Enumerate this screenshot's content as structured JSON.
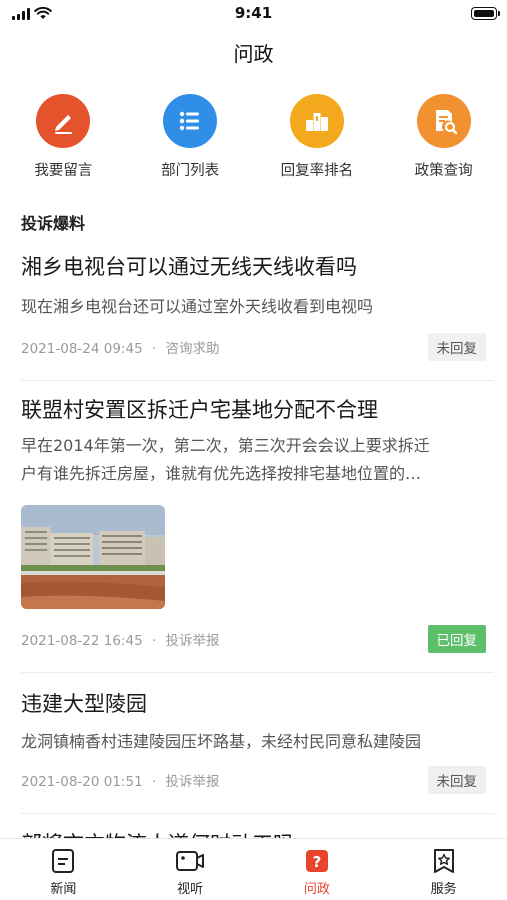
{
  "status_bar": {
    "time": "9:41"
  },
  "nav": {
    "title": "问政"
  },
  "quick_actions": [
    {
      "label": "我要留言",
      "icon": "pen-icon",
      "color": "#e4532b"
    },
    {
      "label": "部门列表",
      "icon": "list-icon",
      "color": "#2f8fe8"
    },
    {
      "label": "回复率排名",
      "icon": "podium-icon",
      "color": "#f4a81d"
    },
    {
      "label": "政策查询",
      "icon": "document-search-icon",
      "color": "#f19130"
    }
  ],
  "section": {
    "title": "投诉爆料"
  },
  "news": [
    {
      "title": "湘乡电视台可以通过无线天线收看吗",
      "summary": "现在湘乡电视台还可以通过室外天线收看到电视吗",
      "date": "2021-08-24 09:45",
      "category": "咨询求助",
      "status": "未回复"
    },
    {
      "title": "联盟村安置区拆迁户宅基地分配不合理",
      "summary_lines": [
        "早在2014年第一次，第二次，第三次开会会议上要求拆迁",
        "户有谁先拆迁房屋，谁就有优先选择按排宅基地位置的…"
      ],
      "date": "2021-08-22 16:45",
      "category": "投诉举报",
      "status": "已回复",
      "image": "residential-buildings-photo"
    },
    {
      "title": "违建大型陵园",
      "summary": "龙洞镇楠香村违建陵园压坏路基，未经村民同意私建陵园",
      "date": "2021-08-20 01:51",
      "category": "投诉举报",
      "status": "未回复"
    }
  ],
  "peek": {
    "title": "部将市方物流人道何时动工吗"
  },
  "separator": "·",
  "tabs": [
    {
      "label": "新闻",
      "icon": "news-icon"
    },
    {
      "label": "视听",
      "icon": "video-icon"
    },
    {
      "label": "问政",
      "icon": "question-icon",
      "active": true
    },
    {
      "label": "服务",
      "icon": "service-star-icon"
    }
  ],
  "colors": {
    "accent": "#e8442c",
    "replied": "#5cc06a"
  }
}
